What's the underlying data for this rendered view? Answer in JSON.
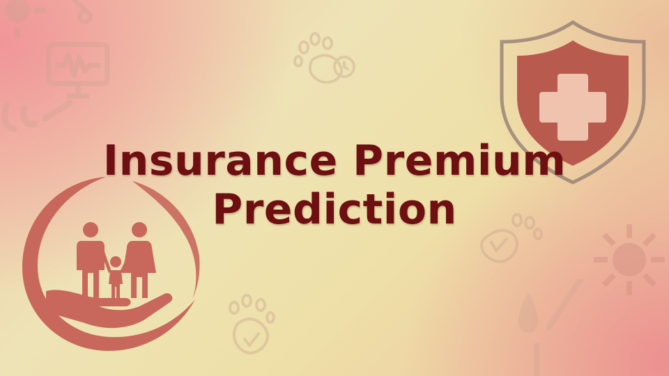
{
  "slide": {
    "title_line1": "Insurance Premium",
    "title_line2": "Prediction"
  },
  "colors": {
    "title": "#6e0f12",
    "icon_fill": "#c8675c",
    "shield_fill": "#b85a4e",
    "watermark": "#c9a48e"
  },
  "icons": [
    "family-care-icon",
    "medical-shield-icon",
    "pet-paw-icon",
    "monitor-ecg-icon",
    "sun-icon",
    "drop-icon"
  ]
}
